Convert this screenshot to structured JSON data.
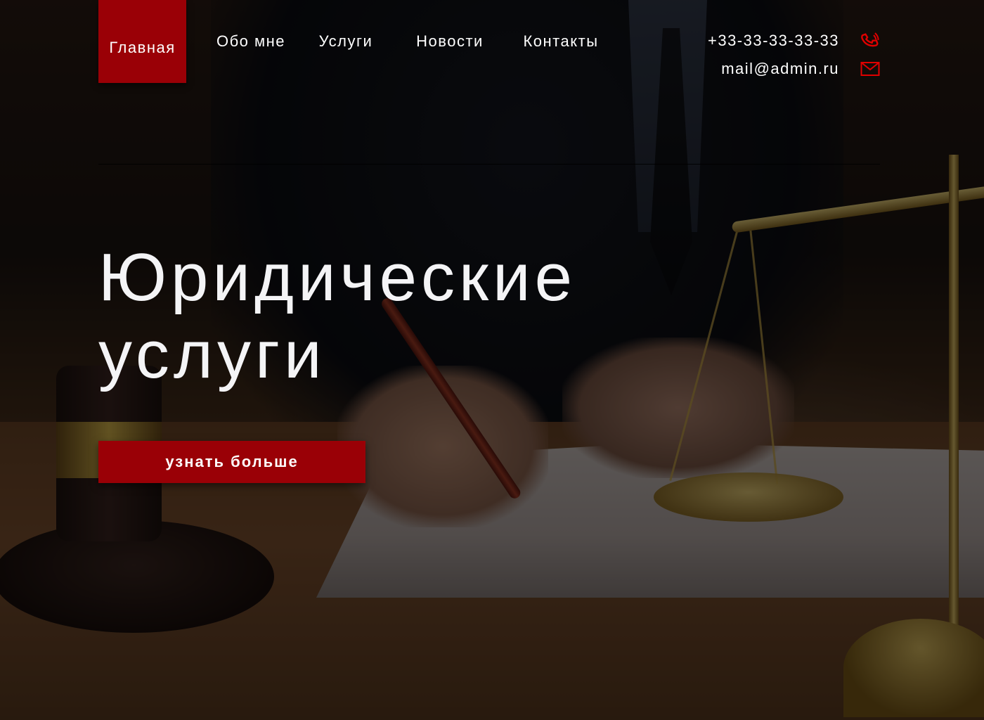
{
  "nav": {
    "items": [
      {
        "label": "Главная",
        "active": true
      },
      {
        "label": "Обо мне"
      },
      {
        "label": "Услуги"
      },
      {
        "label": "Новости"
      },
      {
        "label": "Контакты"
      }
    ]
  },
  "contacts": {
    "phone": "+33-33-33-33-33",
    "email": "mail@admin.ru",
    "phone_icon": "phone-icon",
    "email_icon": "mail-icon"
  },
  "hero": {
    "headline_line1": "Юридические",
    "headline_line2": "услуги",
    "cta_label": "узнать больше"
  },
  "colors": {
    "accent": "#9a0006",
    "text": "#ffffff",
    "icon_accent": "#e00000"
  }
}
